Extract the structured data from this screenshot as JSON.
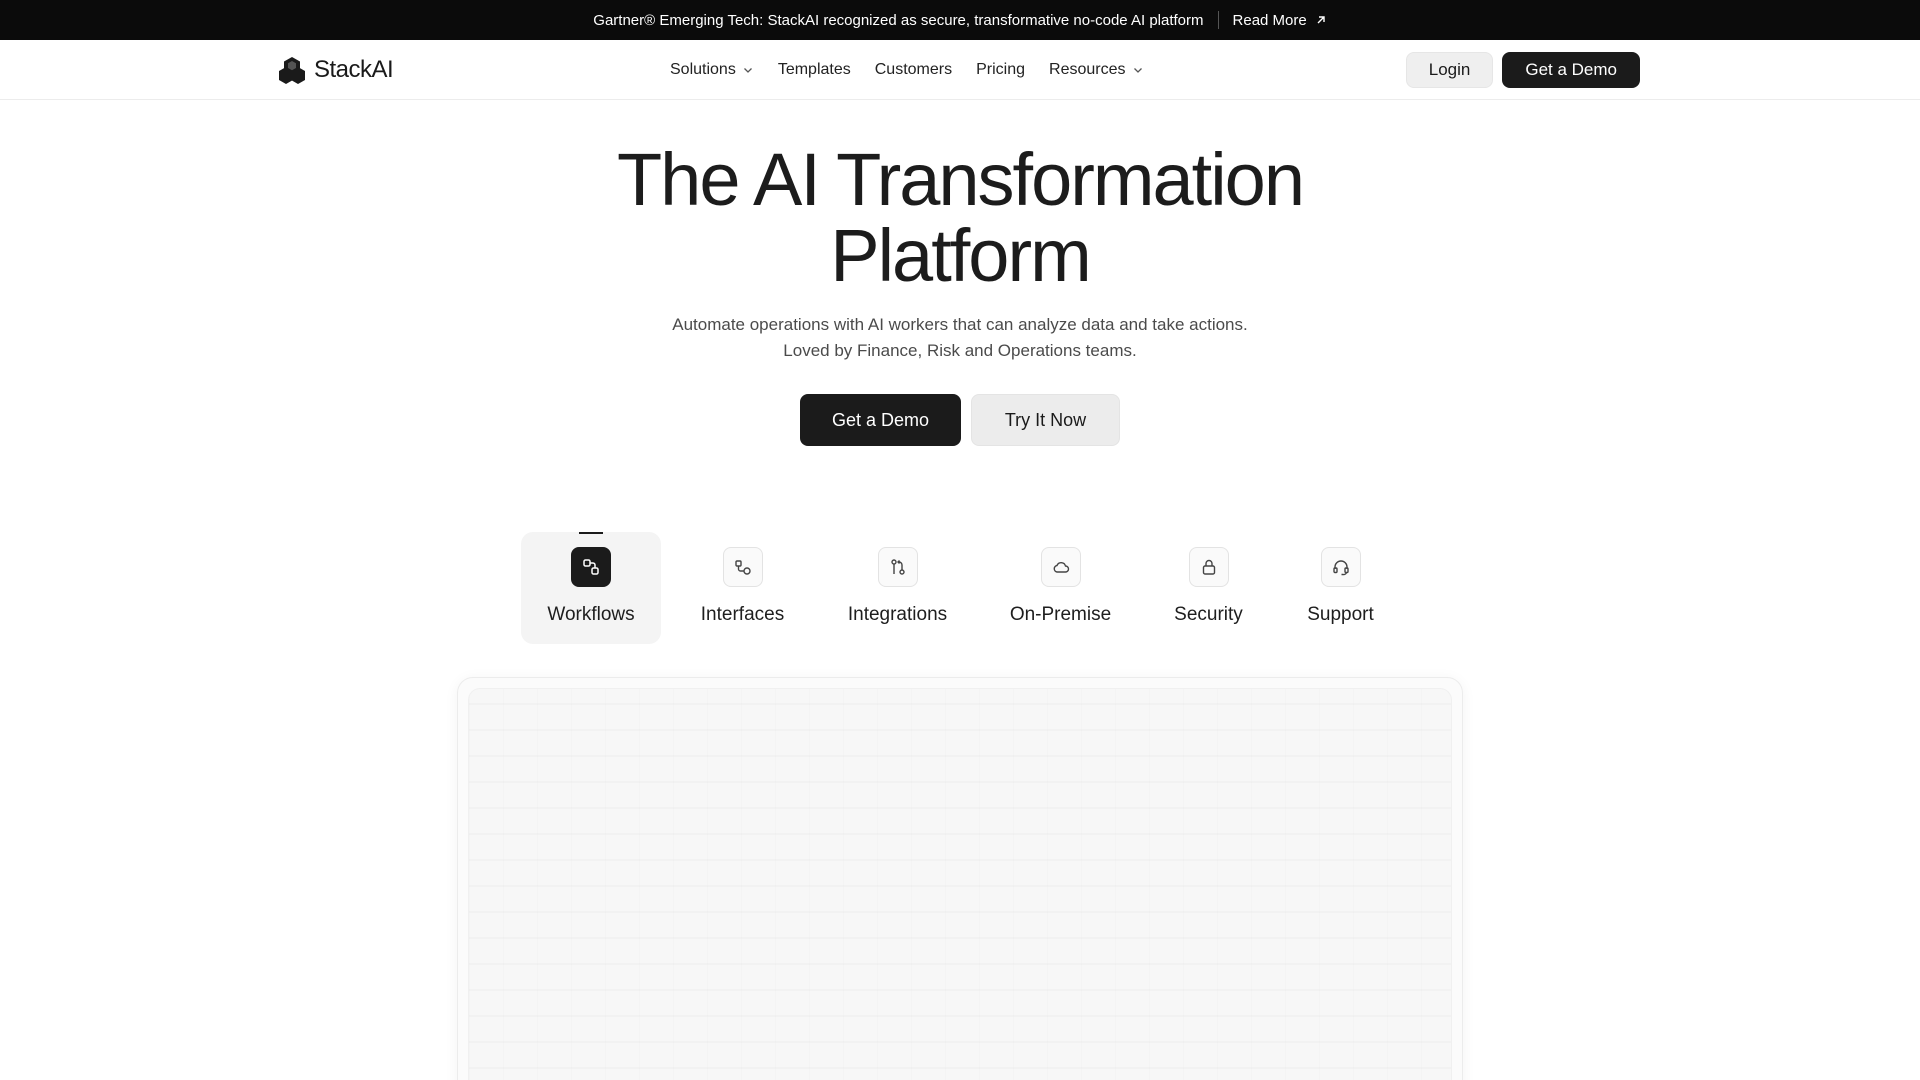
{
  "announcement": {
    "text": "Gartner® Emerging Tech: StackAI recognized as secure, transformative no-code AI platform",
    "link_label": "Read More"
  },
  "nav": {
    "logo_text": "StackAI",
    "links": [
      {
        "label": "Solutions",
        "has_dropdown": true
      },
      {
        "label": "Templates",
        "has_dropdown": false
      },
      {
        "label": "Customers",
        "has_dropdown": false
      },
      {
        "label": "Pricing",
        "has_dropdown": false
      },
      {
        "label": "Resources",
        "has_dropdown": true
      }
    ],
    "login_label": "Login",
    "demo_label": "Get a Demo"
  },
  "hero": {
    "title_line1": "The AI Transformation",
    "title_line2": "Platform",
    "subtitle_line1": "Automate operations with AI workers that can analyze data and take actions.",
    "subtitle_line2": "Loved by Finance, Risk and Operations teams.",
    "primary_cta": "Get a Demo",
    "secondary_cta": "Try It Now"
  },
  "tabs": [
    {
      "label": "Workflows",
      "icon": "workflow-icon",
      "active": true
    },
    {
      "label": "Interfaces",
      "icon": "interfaces-icon",
      "active": false
    },
    {
      "label": "Integrations",
      "icon": "integrations-icon",
      "active": false
    },
    {
      "label": "On-Premise",
      "icon": "cloud-icon",
      "active": false
    },
    {
      "label": "Security",
      "icon": "lock-icon",
      "active": false
    },
    {
      "label": "Support",
      "icon": "headset-icon",
      "active": false
    }
  ],
  "colors": {
    "announcement_bg": "#0b0b0b",
    "primary_button": "#1b1b1b",
    "secondary_button": "#ececec",
    "text_primary": "#1c1c1c",
    "text_muted": "#4b4b4b"
  }
}
